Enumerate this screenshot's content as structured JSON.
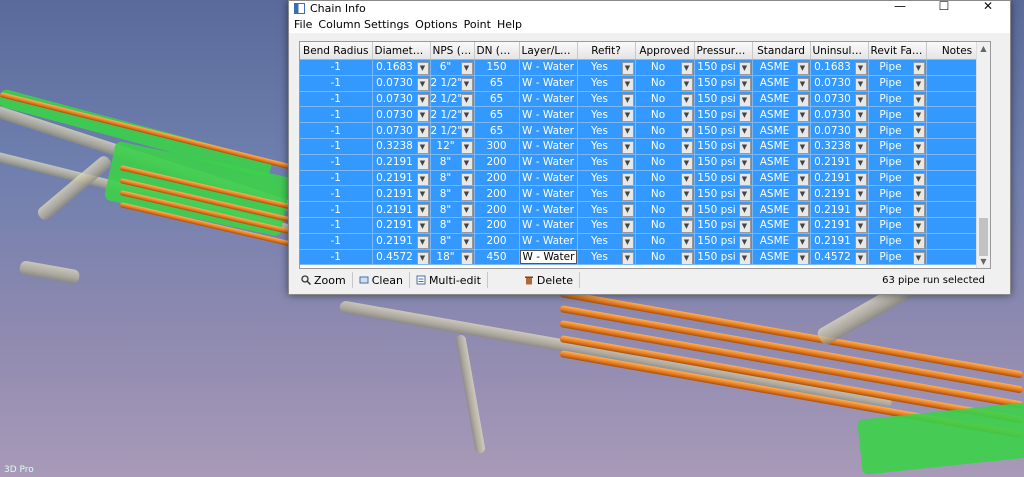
{
  "window": {
    "title": "Chain Info",
    "controls": [
      "—",
      "☐",
      "✕"
    ]
  },
  "menu": [
    "File",
    "Column Settings",
    "Options",
    "Point",
    "Help"
  ],
  "columns": [
    "Bend Radius",
    "Diameter(m)",
    "NPS (in)",
    "DN (mm)",
    "Layer/Level",
    "Refit?",
    "Approved",
    "Pressure Ra...",
    "Standard",
    "Uninsulated...",
    "Revit Family",
    "Notes"
  ],
  "rows": [
    [
      "-1",
      "0.1683",
      "6\"",
      "150",
      "W - Water",
      "Yes",
      "No",
      "150 psi",
      "ASME",
      "0.1683",
      "Pipe",
      ""
    ],
    [
      "-1",
      "0.0730",
      "2 1/2\"",
      "65",
      "W - Water",
      "Yes",
      "No",
      "150 psi",
      "ASME",
      "0.0730",
      "Pipe",
      ""
    ],
    [
      "-1",
      "0.0730",
      "2 1/2\"",
      "65",
      "W - Water",
      "Yes",
      "No",
      "150 psi",
      "ASME",
      "0.0730",
      "Pipe",
      ""
    ],
    [
      "-1",
      "0.0730",
      "2 1/2\"",
      "65",
      "W - Water",
      "Yes",
      "No",
      "150 psi",
      "ASME",
      "0.0730",
      "Pipe",
      ""
    ],
    [
      "-1",
      "0.0730",
      "2 1/2\"",
      "65",
      "W - Water",
      "Yes",
      "No",
      "150 psi",
      "ASME",
      "0.0730",
      "Pipe",
      ""
    ],
    [
      "-1",
      "0.3238",
      "12\"",
      "300",
      "W - Water",
      "Yes",
      "No",
      "150 psi",
      "ASME",
      "0.3238",
      "Pipe",
      ""
    ],
    [
      "-1",
      "0.2191",
      "8\"",
      "200",
      "W - Water",
      "Yes",
      "No",
      "150 psi",
      "ASME",
      "0.2191",
      "Pipe",
      ""
    ],
    [
      "-1",
      "0.2191",
      "8\"",
      "200",
      "W - Water",
      "Yes",
      "No",
      "150 psi",
      "ASME",
      "0.2191",
      "Pipe",
      ""
    ],
    [
      "-1",
      "0.2191",
      "8\"",
      "200",
      "W - Water",
      "Yes",
      "No",
      "150 psi",
      "ASME",
      "0.2191",
      "Pipe",
      ""
    ],
    [
      "-1",
      "0.2191",
      "8\"",
      "200",
      "W - Water",
      "Yes",
      "No",
      "150 psi",
      "ASME",
      "0.2191",
      "Pipe",
      ""
    ],
    [
      "-1",
      "0.2191",
      "8\"",
      "200",
      "W - Water",
      "Yes",
      "No",
      "150 psi",
      "ASME",
      "0.2191",
      "Pipe",
      ""
    ],
    [
      "-1",
      "0.2191",
      "8\"",
      "200",
      "W - Water",
      "Yes",
      "No",
      "150 psi",
      "ASME",
      "0.2191",
      "Pipe",
      ""
    ],
    [
      "-1",
      "0.4572",
      "18\"",
      "450",
      "W - Water",
      "Yes",
      "No",
      "150 psi",
      "ASME",
      "0.4572",
      "Pipe",
      ""
    ]
  ],
  "dropdown_columns": [
    1,
    2,
    5,
    6,
    7,
    8,
    9,
    10
  ],
  "editing_cell": {
    "row": 12,
    "col": 4
  },
  "toolbar": {
    "zoom": "Zoom",
    "clean": "Clean",
    "multi_edit": "Multi-edit",
    "delete": "Delete"
  },
  "status": "63 pipe run selected",
  "viewport": {
    "axis_label": "3D Pro",
    "accent_pipe": "#e2771c",
    "accent_fitting": "#3cd04a"
  }
}
